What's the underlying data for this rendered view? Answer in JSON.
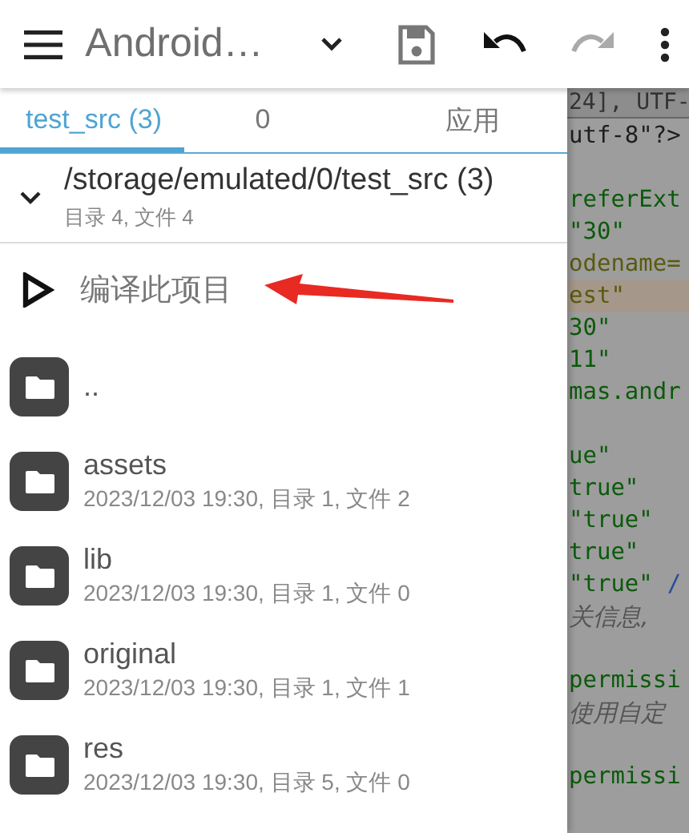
{
  "toolbar": {
    "title": "Android…",
    "undo_disabled": false,
    "redo_disabled": true
  },
  "tabs": [
    {
      "label": "test_src (3)",
      "selected": true
    },
    {
      "label": "0",
      "selected": false
    },
    {
      "label": "应用",
      "selected": false
    }
  ],
  "folder": {
    "path": "/storage/emulated/0/test_src (3)",
    "summary": "目录 4, 文件 4",
    "expanded": true
  },
  "build_action": {
    "label": "编译此项目"
  },
  "files": [
    {
      "name": ".."
    },
    {
      "name": "assets",
      "details": "2023/12/03 19:30, 目录 1, 文件 2"
    },
    {
      "name": "lib",
      "details": "2023/12/03 19:30, 目录 1, 文件 0"
    },
    {
      "name": "original",
      "details": "2023/12/03 19:30, 目录 1, 文件 1"
    },
    {
      "name": "res",
      "details": "2023/12/03 19:30, 目录 5, 文件 0"
    }
  ],
  "editor": {
    "header": "24], UTF-",
    "lines": [
      {
        "highlighted": false,
        "segments": [
          {
            "kind": "plain",
            "text": "utf-8\"?>"
          }
        ]
      },
      {
        "highlighted": false
      },
      {
        "highlighted": false,
        "segments": [
          {
            "kind": "attr",
            "text": "referExt"
          }
        ]
      },
      {
        "highlighted": false,
        "segments": [
          {
            "kind": "attr",
            "text": "\"30\""
          }
        ]
      },
      {
        "highlighted": false,
        "segments": [
          {
            "kind": "name",
            "text": "odename="
          }
        ]
      },
      {
        "highlighted": true,
        "segments": [
          {
            "kind": "name",
            "text": "est\""
          }
        ]
      },
      {
        "highlighted": false,
        "segments": [
          {
            "kind": "attr",
            "text": "30\""
          }
        ]
      },
      {
        "highlighted": false,
        "segments": [
          {
            "kind": "attr",
            "text": "11\""
          }
        ]
      },
      {
        "highlighted": false,
        "segments": [
          {
            "kind": "attr",
            "text": "mas.andr"
          }
        ]
      },
      {
        "highlighted": false
      },
      {
        "highlighted": false,
        "segments": [
          {
            "kind": "attr",
            "text": "ue\""
          }
        ]
      },
      {
        "highlighted": false,
        "segments": [
          {
            "kind": "attr",
            "text": "true\""
          }
        ]
      },
      {
        "highlighted": false,
        "segments": [
          {
            "kind": "attr",
            "text": "\"true\""
          }
        ]
      },
      {
        "highlighted": false,
        "segments": [
          {
            "kind": "attr",
            "text": "true\""
          }
        ]
      },
      {
        "highlighted": false,
        "segments": [
          {
            "kind": "attr",
            "text": "\"true\""
          },
          {
            "kind": "tag",
            "text": "/"
          }
        ]
      },
      {
        "highlighted": false,
        "segments": [
          {
            "kind": "comment",
            "text": "关信息,"
          }
        ]
      },
      {
        "highlighted": false
      },
      {
        "highlighted": false,
        "segments": [
          {
            "kind": "attr",
            "text": "permissi"
          }
        ]
      },
      {
        "highlighted": false,
        "segments": [
          {
            "kind": "comment",
            "text": "使用自定"
          }
        ]
      },
      {
        "highlighted": false
      },
      {
        "highlighted": false,
        "segments": [
          {
            "kind": "attr",
            "text": "permissi"
          }
        ]
      }
    ]
  }
}
